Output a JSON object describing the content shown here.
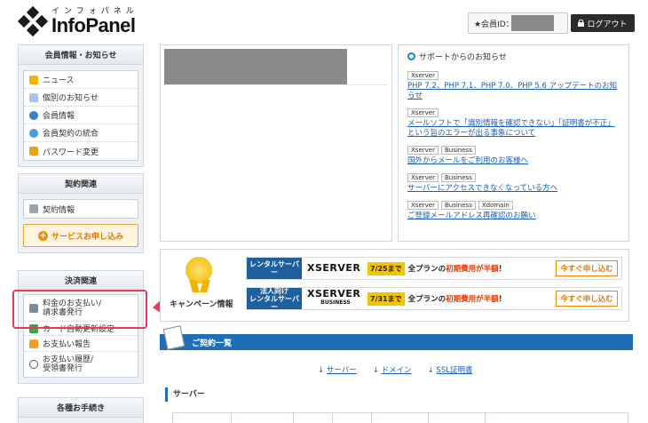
{
  "header": {
    "logo_kana": "インフォパネル",
    "logo_main": "InfoPanel",
    "member_label": "★会員ID：",
    "logout_label": "ログアウト"
  },
  "sidebar": {
    "member": {
      "title": "会員情報・お知らせ",
      "items": [
        {
          "label": "ニュース",
          "icon": "megaphone-icon"
        },
        {
          "label": "個別のお知らせ",
          "icon": "letter-icon"
        },
        {
          "label": "会員情報",
          "icon": "user-icon"
        },
        {
          "label": "会員契約の統合",
          "icon": "users-icon"
        },
        {
          "label": "パスワード変更",
          "icon": "lock-icon"
        }
      ]
    },
    "contract": {
      "title": "契約関連",
      "items": [
        {
          "label": "契約情報",
          "icon": "pen-icon"
        }
      ],
      "apply_label": "サービスお申し込み"
    },
    "payment": {
      "title": "決済関連",
      "items": [
        {
          "label_line1": "料金のお支払い/",
          "label_line2": "請求書発行",
          "icon": "invoice-icon"
        },
        {
          "label": "カード自動更新設定",
          "icon": "card-icon"
        },
        {
          "label": "お支払い報告",
          "icon": "mail-icon"
        },
        {
          "label_line1": "お支払い履歴/",
          "label_line2": "受領書発行",
          "icon": "clock-icon"
        }
      ]
    },
    "procedures": {
      "title": "各種お手続き"
    }
  },
  "support": {
    "title": "サポートからのお知らせ",
    "news": [
      {
        "tags": [
          "Xserver"
        ],
        "text": "PHP 7.2、PHP 7.1、PHP 7.0、PHP 5.6 アップデートのお知らせ"
      },
      {
        "tags": [
          "Xserver"
        ],
        "text": "メールソフトで「識別情報を確認できない」「証明書が不正」という旨のエラーが出る事象について"
      },
      {
        "tags": [
          "Xserver",
          "Business"
        ],
        "text": "国外からメールをご利用のお客様へ"
      },
      {
        "tags": [
          "Xserver",
          "Business"
        ],
        "text": "サーバーにアクセスできなくなっている方へ"
      },
      {
        "tags": [
          "Xserver",
          "Business",
          "Xdomain"
        ],
        "text": "ご登録メールアドレス再確認のお願い"
      }
    ]
  },
  "campaign": {
    "label": "キャンペーン情報",
    "promos": [
      {
        "kind": "レンタルサーバー",
        "brand": "XSERVER",
        "brand_sub": "",
        "date": "7/25まで",
        "text_pre": "全プランの",
        "text_em": "初期費用が半額",
        "text_post": "！",
        "button": "今すぐ申し込む"
      },
      {
        "kind_line1": "法人向け",
        "kind_line2": "レンタルサーバー",
        "brand": "XSERVER",
        "brand_sub": "BUSINESS",
        "date": "7/31まで",
        "text_pre": "全プランの",
        "text_em": "初期費用が半額",
        "text_post": "！",
        "button": "今すぐ申し込む"
      }
    ]
  },
  "contracts": {
    "title": "ご契約一覧",
    "links": [
      "サーバー",
      "ドメイン",
      "SSL証明書"
    ],
    "section_title": "サーバー"
  }
}
